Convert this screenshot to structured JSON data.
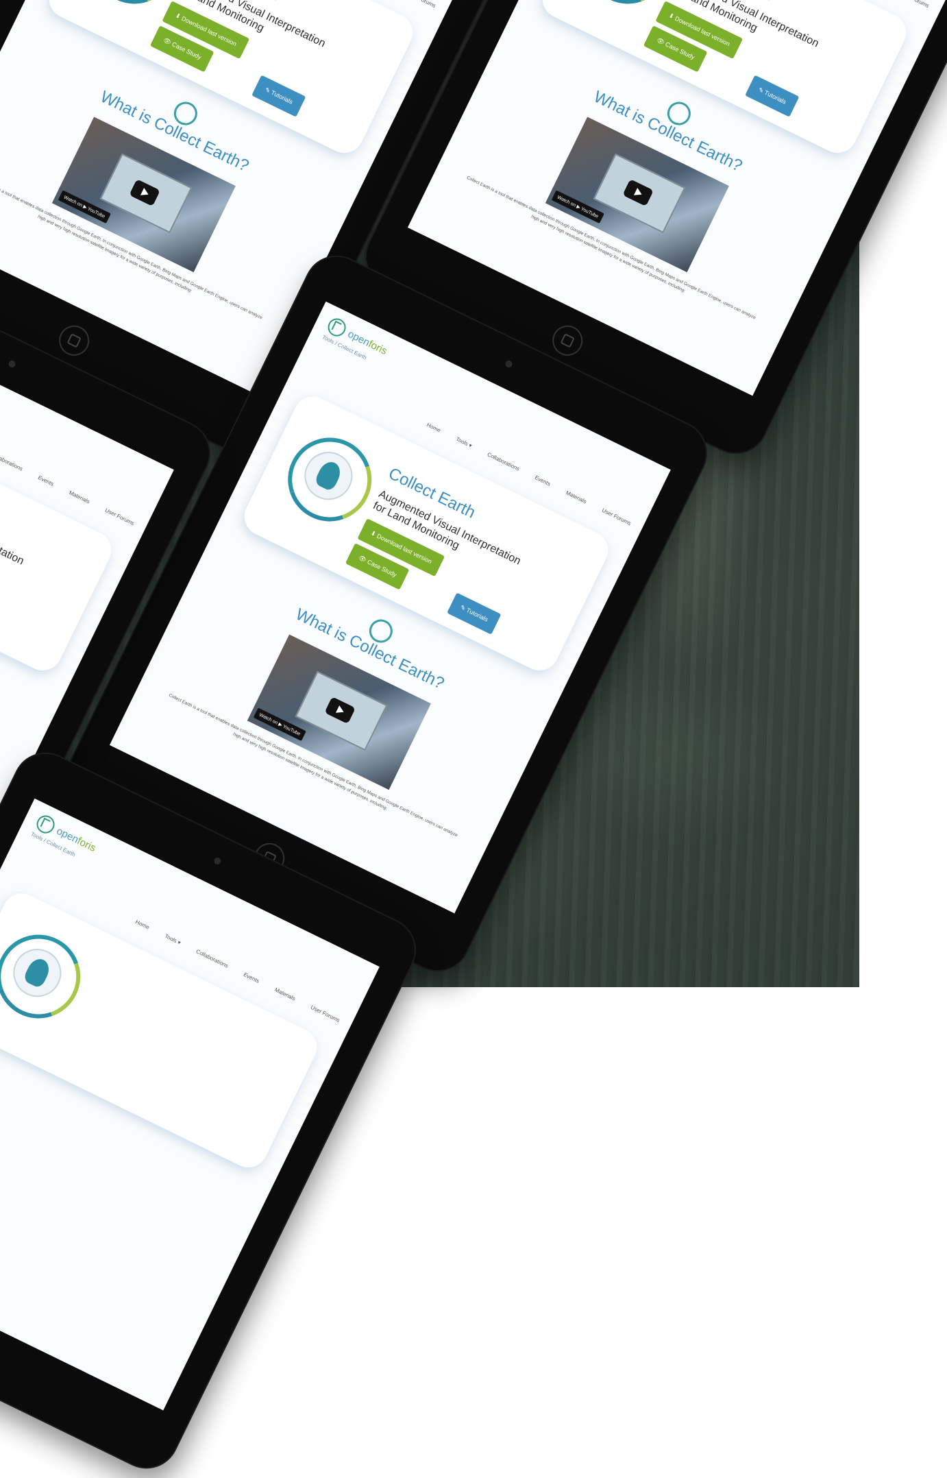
{
  "site": {
    "brand_prefix": "open",
    "brand_suffix": "foris",
    "breadcrumb": "Tools / Collect Earth"
  },
  "nav": {
    "items": [
      "Home",
      "Tools ▾",
      "Collaborations",
      "Events",
      "Materials",
      "User Forums"
    ]
  },
  "hero": {
    "title": "Collect Earth",
    "subtitle": "Augmented Visual Interpretation for Land Monitoring",
    "download_label": "⬇ Download last version",
    "case_study_label": "👁 Case Study",
    "tutorials_label": "✎ Tutorials"
  },
  "what": {
    "title": "What is Collect Earth?",
    "video_watch_label": "Watch on ▶ YouTube",
    "description": "Collect Earth is a tool that enables data collection through Google Earth. In conjunction with Google Earth, Bing Maps and Google Earth Engine, users can analyze high and very high resolution satellite imagery for a wide variety of purposes, including:"
  },
  "colors": {
    "accent_blue": "#3c8fc4",
    "accent_green": "#7cb02a",
    "forest_bg": "#35413c"
  }
}
